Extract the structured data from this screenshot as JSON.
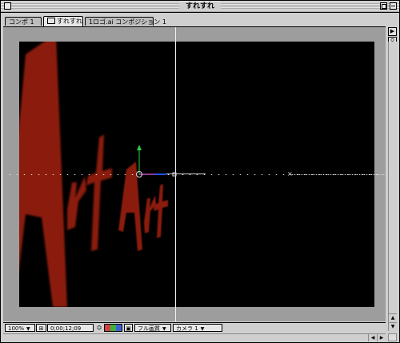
{
  "window": {
    "title": "すれすれ"
  },
  "tabs": [
    {
      "label": "コンポ 1",
      "active": false
    },
    {
      "label": "すれすれ",
      "active": true
    },
    {
      "label": "1ロゴ.ai コンポジション 1",
      "active": false
    }
  ],
  "canvas": {
    "text": "ArtArt",
    "text_color": "#8b1a0a",
    "background_color": "#000000",
    "pasteboard_color": "#9d9d9d"
  },
  "statusbar": {
    "zoom": "100%",
    "timecode": "0;00;12;09",
    "resolution": "フル画質",
    "view": "カメラ 1"
  },
  "icons": {
    "grid": "grid-icon",
    "snapshot": "camera-snapshot-icon",
    "channels": "rgb-channel-icon",
    "region": "region-of-interest-icon"
  }
}
